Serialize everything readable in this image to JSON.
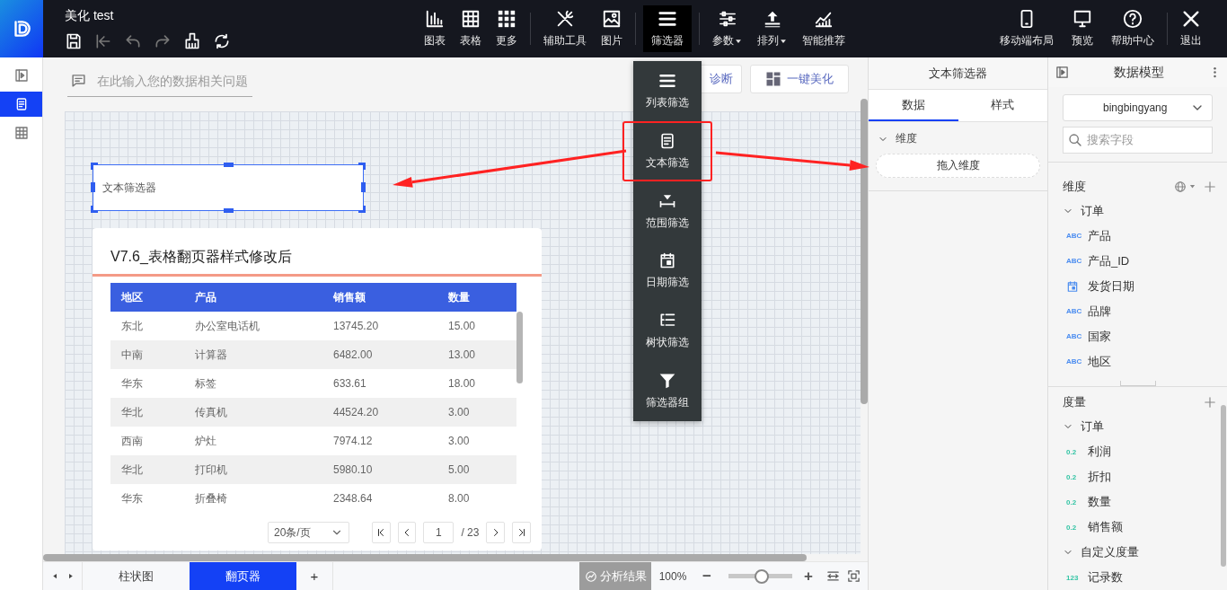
{
  "app": {
    "title": "美化 test",
    "quick_actions": [
      {
        "kind": "save",
        "disabled": false
      },
      {
        "kind": "collapse",
        "disabled": true
      },
      {
        "kind": "undo",
        "disabled": true
      },
      {
        "kind": "redo",
        "disabled": true
      },
      {
        "kind": "format",
        "disabled": false
      },
      {
        "kind": "refresh",
        "disabled": false
      }
    ]
  },
  "main_menu": [
    [
      {
        "kind": "chart",
        "label": "图表",
        "selected": false,
        "dropdown": false
      },
      {
        "kind": "table",
        "label": "表格",
        "selected": false,
        "dropdown": false
      },
      {
        "kind": "more",
        "label": "更多",
        "selected": false,
        "dropdown": false
      }
    ],
    [
      {
        "kind": "tools",
        "label": "辅助工具",
        "selected": false,
        "dropdown": false
      },
      {
        "kind": "image",
        "label": "图片",
        "selected": false,
        "dropdown": false
      }
    ],
    [
      {
        "kind": "filter",
        "label": "筛选器",
        "selected": true,
        "dropdown": false
      }
    ],
    [
      {
        "kind": "params",
        "label": "参数",
        "selected": false,
        "dropdown": true
      },
      {
        "kind": "sort",
        "label": "排列",
        "selected": false,
        "dropdown": true
      },
      {
        "kind": "smart",
        "label": "智能推荐",
        "selected": false,
        "dropdown": false
      }
    ]
  ],
  "right_menu": [
    [
      {
        "kind": "mobile",
        "label": "移动端布局",
        "selected": false,
        "dropdown": false
      },
      {
        "kind": "preview",
        "label": "预览",
        "selected": false,
        "dropdown": false
      },
      {
        "kind": "help",
        "label": "帮助中心",
        "selected": false,
        "dropdown": false
      }
    ],
    [
      {
        "kind": "exit",
        "label": "退出",
        "selected": false,
        "dropdown": false
      }
    ]
  ],
  "left_rail": [
    {
      "kind": "panel",
      "selected": false
    },
    {
      "kind": "report",
      "selected": true
    },
    {
      "kind": "table",
      "selected": false
    }
  ],
  "question_bar": {
    "placeholder": "在此输入您的数据相关问题"
  },
  "canvas_actions": [
    {
      "kind": "diagnose",
      "label": "诊断"
    },
    {
      "kind": "beautify",
      "label": "一键美化"
    }
  ],
  "filter_widget": {
    "label": "文本筛选器",
    "selected": true
  },
  "table_card": {
    "title": "V7.6_表格翻页器样式修改后",
    "columns": [
      "地区",
      "产品",
      "销售额",
      "数量"
    ],
    "rows": [
      [
        "东北",
        "办公室电话机",
        "13745.20",
        "15.00"
      ],
      [
        "中南",
        "计算器",
        "6482.00",
        "13.00"
      ],
      [
        "华东",
        "标签",
        "633.61",
        "18.00"
      ],
      [
        "华北",
        "传真机",
        "44524.20",
        "3.00"
      ],
      [
        "西南",
        "炉灶",
        "7974.12",
        "3.00"
      ],
      [
        "华北",
        "打印机",
        "5980.10",
        "5.00"
      ],
      [
        "华东",
        "折叠椅",
        "2348.64",
        "8.00"
      ]
    ],
    "pagination": {
      "page_size": "20条/页",
      "page": "1",
      "total": "/ 23"
    }
  },
  "filter_menu": [
    {
      "kind": "list",
      "label": "列表筛选",
      "highlighted": false
    },
    {
      "kind": "text",
      "label": "文本筛选",
      "highlighted": true
    },
    {
      "kind": "range",
      "label": "范围筛选",
      "highlighted": false
    },
    {
      "kind": "date",
      "label": "日期筛选",
      "highlighted": false
    },
    {
      "kind": "tree",
      "label": "树状筛选",
      "highlighted": false
    },
    {
      "kind": "group",
      "label": "筛选器组",
      "highlighted": false
    }
  ],
  "bottom_bar": {
    "sheets": [
      {
        "label": "柱状图",
        "selected": false
      },
      {
        "label": "翻页器",
        "selected": true
      }
    ],
    "add_label": "+",
    "analysis": {
      "label": "分析结果",
      "disabled": true
    },
    "zoom": {
      "reading": "100%",
      "minus": "−",
      "plus": "+",
      "level": 0.52
    }
  },
  "property_panel": {
    "title": "文本筛选器",
    "tabs": [
      {
        "label": "数据",
        "selected": true
      },
      {
        "label": "样式",
        "selected": false
      }
    ],
    "section": {
      "label": "维度",
      "expanded": true
    },
    "drop_zone": "拖入维度"
  },
  "data_model": {
    "title": "数据模型",
    "dataset": "bingbingyang",
    "search": {
      "placeholder": "搜索字段"
    },
    "dimensions": {
      "label": "维度",
      "groups": [
        {
          "label": "订单",
          "expanded": true,
          "children": [
            {
              "label": "产品",
              "kind": "text",
              "badge": "ABC"
            },
            {
              "label": "产品_ID",
              "kind": "text",
              "badge": "ABC"
            },
            {
              "label": "发货日期",
              "kind": "date"
            },
            {
              "label": "品牌",
              "kind": "text",
              "badge": "ABC"
            },
            {
              "label": "国家",
              "kind": "text",
              "badge": "ABC"
            },
            {
              "label": "地区",
              "kind": "text",
              "badge": "ABC"
            }
          ]
        }
      ]
    },
    "measures": {
      "label": "度量",
      "groups": [
        {
          "label": "订单",
          "expanded": true,
          "children": [
            {
              "label": "利润",
              "kind": "number",
              "badge": "0.2"
            },
            {
              "label": "折扣",
              "kind": "number",
              "badge": "0.2"
            },
            {
              "label": "数量",
              "kind": "number",
              "badge": "0.2"
            },
            {
              "label": "销售额",
              "kind": "number",
              "badge": "0.2"
            }
          ]
        },
        {
          "label": "自定义度量",
          "expanded": true,
          "children": [
            {
              "label": "记录数",
              "kind": "number",
              "badge": "123"
            }
          ]
        }
      ]
    }
  }
}
